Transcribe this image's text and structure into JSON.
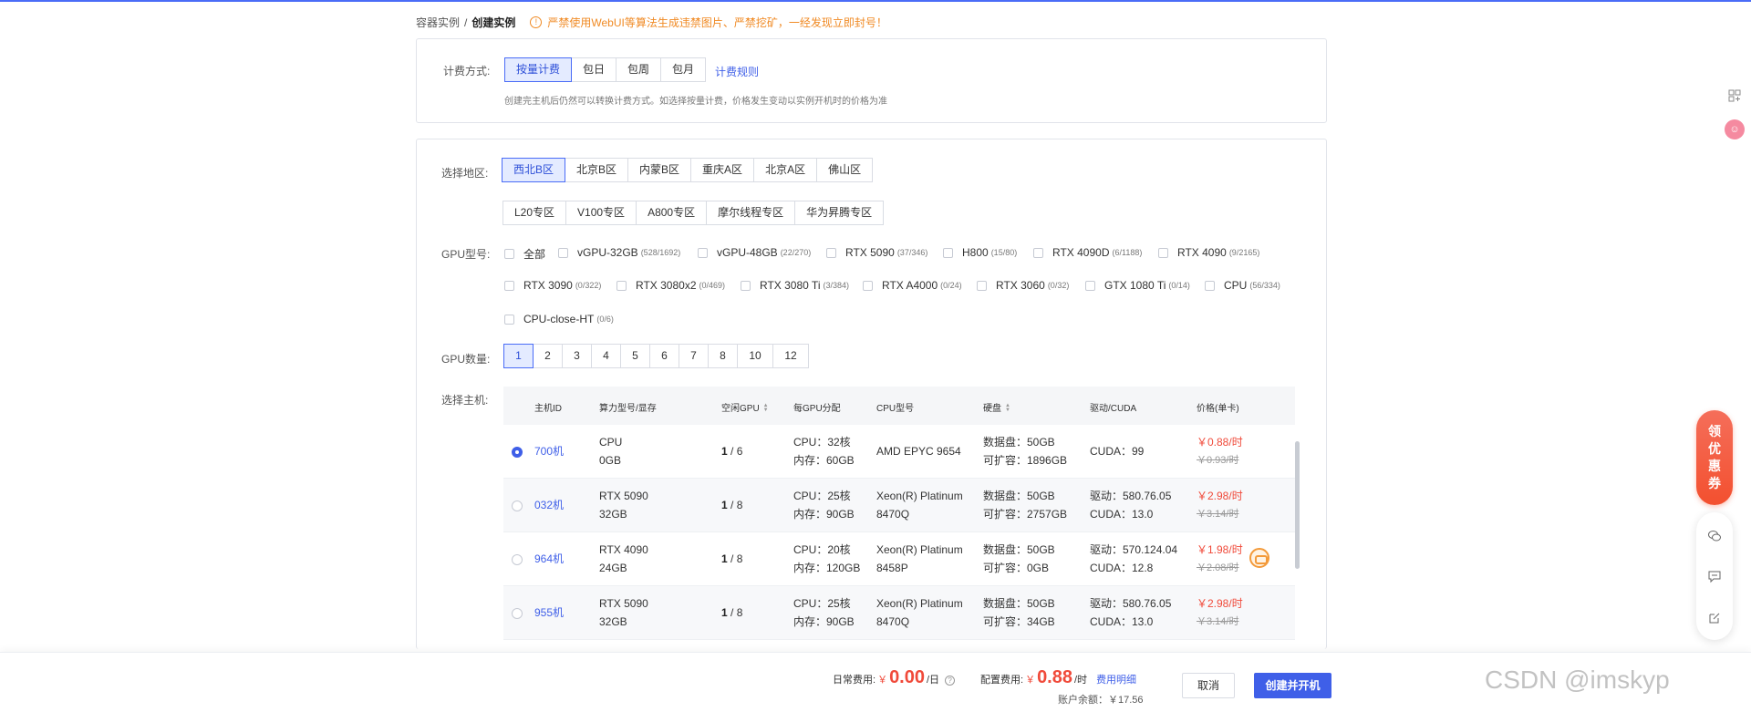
{
  "breadcrumb": {
    "parent": "容器实例",
    "current": "创建实例"
  },
  "warning": {
    "icon": "info-circle-icon",
    "text": "严禁使用WebUI等算法生成违禁图片、严禁挖矿，一经发现立即封号！"
  },
  "billing": {
    "label": "计费方式:",
    "options": [
      "按量计费",
      "包日",
      "包周",
      "包月"
    ],
    "selected": "按量计费",
    "rules_link": "计费规则",
    "hint": "创建完主机后仍然可以转换计费方式。如选择按量计费，价格发生变动以实例开机时的价格为准"
  },
  "region": {
    "label": "选择地区:",
    "row1": [
      "西北B区",
      "北京B区",
      "内蒙B区",
      "重庆A区",
      "北京A区",
      "佛山区"
    ],
    "row2": [
      "L20专区",
      "V100专区",
      "A800专区",
      "摩尔线程专区",
      "华为昇腾专区"
    ],
    "selected": "西北B区"
  },
  "gpu_model": {
    "label": "GPU型号:",
    "options": [
      {
        "name": "全部",
        "count": ""
      },
      {
        "name": "vGPU-32GB",
        "count": "(528/1692)"
      },
      {
        "name": "vGPU-48GB",
        "count": "(22/270)"
      },
      {
        "name": "RTX 5090",
        "count": "(37/346)"
      },
      {
        "name": "H800",
        "count": "(15/80)"
      },
      {
        "name": "RTX 4090D",
        "count": "(6/1188)"
      },
      {
        "name": "RTX 4090",
        "count": "(9/2165)"
      },
      {
        "name": "RTX 3090",
        "count": "(0/322)"
      },
      {
        "name": "RTX 3080x2",
        "count": "(0/469)"
      },
      {
        "name": "RTX 3080 Ti",
        "count": "(3/384)"
      },
      {
        "name": "RTX A4000",
        "count": "(0/24)"
      },
      {
        "name": "RTX 3060",
        "count": "(0/32)"
      },
      {
        "name": "GTX 1080 Ti",
        "count": "(0/14)"
      },
      {
        "name": "CPU",
        "count": "(56/334)"
      },
      {
        "name": "CPU-close-HT",
        "count": "(0/6)"
      }
    ]
  },
  "gpu_count": {
    "label": "GPU数量:",
    "options": [
      "1",
      "2",
      "3",
      "4",
      "5",
      "6",
      "7",
      "8",
      "10",
      "12"
    ],
    "selected": "1"
  },
  "host": {
    "label": "选择主机:",
    "columns": [
      "主机ID",
      "算力型号/显存",
      "空闲GPU",
      "每GPU分配",
      "CPU型号",
      "硬盘",
      "驱动/CUDA",
      "价格(单卡)"
    ],
    "rows": [
      {
        "id": "700机",
        "model": "CPU",
        "mem": "0GB",
        "idle": "1",
        "total": "/ 6",
        "cpu": "CPU：32核",
        "ram": "内存：60GB",
        "cpu_model_1": "AMD EPYC 9654",
        "cpu_model_2": "",
        "disk": "数据盘：50GB",
        "expand": "可扩容：1896GB",
        "driver": "",
        "cuda": "CUDA：99",
        "price": "￥0.88/时",
        "old_price": "￥0.93/时",
        "selected": true
      },
      {
        "id": "032机",
        "model": "RTX 5090",
        "mem": "32GB",
        "idle": "1",
        "total": "/ 8",
        "cpu": "CPU：25核",
        "ram": "内存：90GB",
        "cpu_model_1": "Xeon(R) Platinum",
        "cpu_model_2": "8470Q",
        "disk": "数据盘：50GB",
        "expand": "可扩容：2757GB",
        "driver": "驱动：580.76.05",
        "cuda": "CUDA：13.0",
        "price": "￥2.98/时",
        "old_price": "￥3.14/时",
        "selected": false
      },
      {
        "id": "964机",
        "model": "RTX 4090",
        "mem": "24GB",
        "idle": "1",
        "total": "/ 8",
        "cpu": "CPU：20核",
        "ram": "内存：120GB",
        "cpu_model_1": "Xeon(R) Platinum",
        "cpu_model_2": "8458P",
        "disk": "数据盘：50GB",
        "expand": "可扩容：0GB",
        "driver": "驱动：570.124.04",
        "cuda": "CUDA：12.8",
        "price": "￥1.98/时",
        "old_price": "￥2.08/时",
        "selected": false
      },
      {
        "id": "955机",
        "model": "RTX 5090",
        "mem": "32GB",
        "idle": "1",
        "total": "/ 8",
        "cpu": "CPU：25核",
        "ram": "内存：90GB",
        "cpu_model_1": "Xeon(R) Platinum",
        "cpu_model_2": "8470Q",
        "disk": "数据盘：50GB",
        "expand": "可扩容：34GB",
        "driver": "驱动：580.76.05",
        "cuda": "CUDA：13.0",
        "price": "￥2.98/时",
        "old_price": "￥3.14/时",
        "selected": false
      }
    ]
  },
  "footer": {
    "daily_label": "日常费用:",
    "daily_currency": "￥",
    "daily_amount": "0.00",
    "daily_unit": "/日",
    "config_label": "配置费用:",
    "config_currency": "￥",
    "config_amount": "0.88",
    "config_unit": "/时",
    "fee_detail_link": "费用明细",
    "balance": "账户余额：￥17.56",
    "cancel": "取消",
    "create": "创建并开机"
  },
  "side": {
    "coupon_chars": [
      "领",
      "优",
      "惠",
      "券"
    ],
    "icons": [
      "apps-icon",
      "avatar-icon",
      "wechat-icon",
      "message-icon",
      "edit-icon"
    ]
  },
  "watermark": "CSDN @imskyp",
  "colors": {
    "accent": "#3f5fe8",
    "price": "#f04a3a",
    "warning": "#f08a24"
  }
}
